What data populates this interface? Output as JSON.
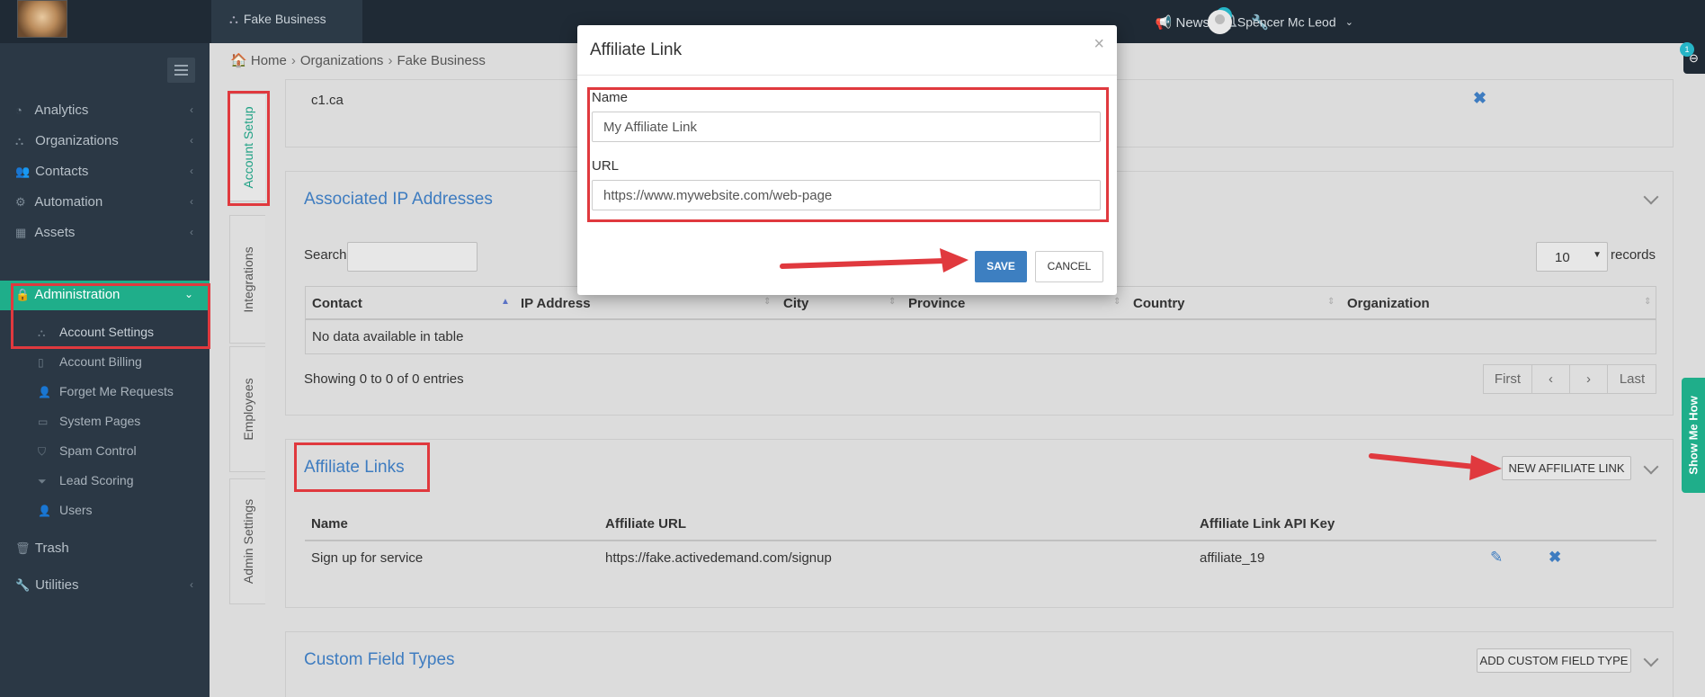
{
  "topbar": {
    "business_tab": "Fake Business",
    "news_label": "News",
    "notification_count": "1",
    "user_name": "Spencer Mc Leod"
  },
  "sidebar": {
    "items": [
      {
        "label": "Analytics",
        "icon": "dashboard-icon"
      },
      {
        "label": "Organizations",
        "icon": "sitemap-icon"
      },
      {
        "label": "Contacts",
        "icon": "users-icon"
      },
      {
        "label": "Automation",
        "icon": "cogs-icon"
      },
      {
        "label": "Assets",
        "icon": "grid-icon"
      },
      {
        "label": "Administration",
        "icon": "lock-icon"
      }
    ],
    "sub_items": [
      {
        "label": "Account Settings",
        "icon": "sitemap-icon"
      },
      {
        "label": "Account Billing",
        "icon": "file-icon"
      },
      {
        "label": "Forget Me Requests",
        "icon": "user-x-icon"
      },
      {
        "label": "System Pages",
        "icon": "window-icon"
      },
      {
        "label": "Spam Control",
        "icon": "shield-icon"
      },
      {
        "label": "Lead Scoring",
        "icon": "filter-icon"
      },
      {
        "label": "Users",
        "icon": "user-icon"
      }
    ],
    "bottom_items": [
      {
        "label": "Trash",
        "icon": "trash-icon"
      },
      {
        "label": "Utilities",
        "icon": "wrench-icon"
      }
    ],
    "active_color": "#1fae8a"
  },
  "breadcrumb": {
    "home": "Home",
    "organizations": "Organizations",
    "current": "Fake Business"
  },
  "vertical_tabs": [
    "Account Setup",
    "Integrations",
    "Employees",
    "Admin Settings"
  ],
  "domains_panel": {
    "row_value": "c1.ca"
  },
  "ip_panel": {
    "title": "Associated IP Addresses",
    "search_label": "Search:",
    "records_value": "10",
    "records_label": "records",
    "columns": [
      "Contact",
      "IP Address",
      "City",
      "Province",
      "Country",
      "Organization"
    ],
    "empty_text": "No data available in table",
    "showing_text": "Showing 0 to 0 of 0 entries",
    "pager": [
      "First",
      "‹",
      "›",
      "Last"
    ]
  },
  "affiliate_panel": {
    "title": "Affiliate Links",
    "new_button": "NEW AFFILIATE LINK",
    "columns": [
      "Name",
      "Affiliate URL",
      "Affiliate Link API Key"
    ],
    "rows": [
      {
        "name": "Sign up for service",
        "url": "https://fake.activedemand.com/signup",
        "api_key": "affiliate_19"
      }
    ]
  },
  "custom_fields_panel": {
    "title": "Custom Field Types",
    "add_button": "ADD CUSTOM FIELD TYPE"
  },
  "modal": {
    "title": "Affiliate Link",
    "close": "×",
    "name_label": "Name",
    "name_value": "My Affiliate Link",
    "url_label": "URL",
    "url_value": "https://www.mywebsite.com/web-page",
    "save_label": "SAVE",
    "cancel_label": "CANCEL"
  },
  "show_me_how": "Show Me How",
  "annotation_color": "#e0393e"
}
